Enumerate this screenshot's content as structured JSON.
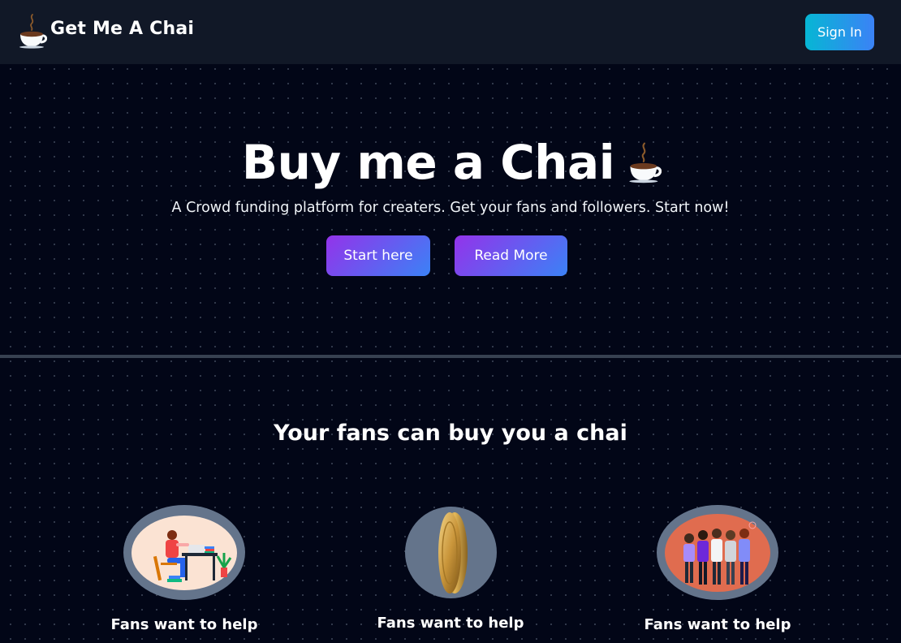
{
  "navbar": {
    "brand_title": "Get Me A Chai",
    "brand_icon": "tea-cup-icon",
    "signin_label": "Sign In"
  },
  "hero": {
    "title": "Buy me a Chai",
    "title_icon": "tea-cup-icon",
    "subtitle": "A Crowd funding platform for creaters. Get your fans and followers. Start now!",
    "start_label": "Start here",
    "read_more_label": "Read More"
  },
  "features": {
    "title": "Your fans can buy you a chai",
    "items": [
      {
        "label": "Fans want to help",
        "icon": "person-working-illustration"
      },
      {
        "label": "Fans want to help",
        "icon": "gold-coin-icon"
      },
      {
        "label": "Fans want to help",
        "icon": "group-of-people-illustration"
      }
    ]
  },
  "colors": {
    "background": "#020617",
    "navbar": "#111827",
    "signin_gradient": [
      "#06b6d4",
      "#3b82f6"
    ],
    "button_gradient": [
      "#9333ea",
      "#3b82f6"
    ],
    "feature_circle": "#64748b",
    "divider": "#374151"
  }
}
